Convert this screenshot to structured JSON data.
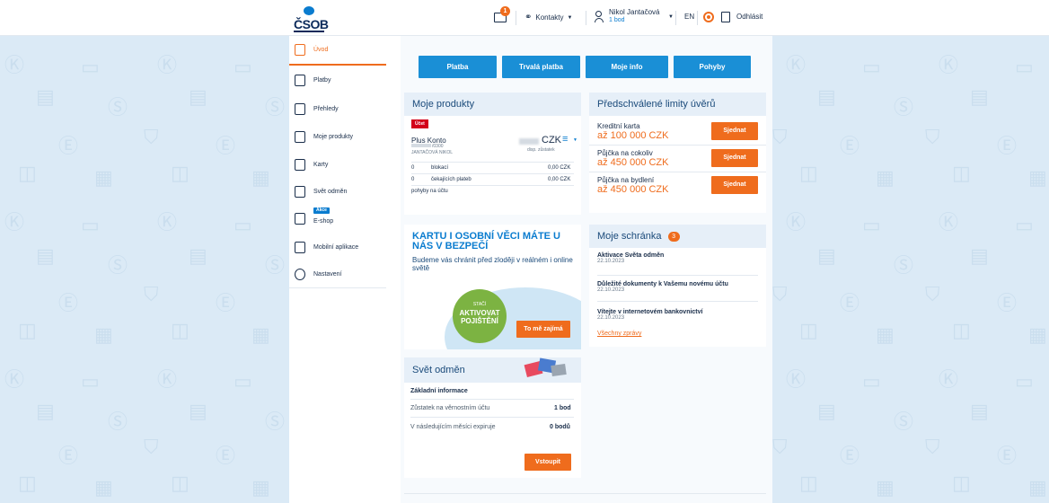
{
  "brand": {
    "logo_text": "ČSOB",
    "accent": "#ef6c1d",
    "primary": "#1a8fd6"
  },
  "header": {
    "mail_count": "1",
    "contacts_label": "Kontakty",
    "user_name": "Nikol Jantačová",
    "user_points": "1 bod",
    "lang": "EN",
    "logout_label": "Odhlásit"
  },
  "sidebar": {
    "items": [
      {
        "label": "Úvod",
        "icon": "home-icon",
        "active": true
      },
      {
        "label": "Platby",
        "icon": "payments-icon"
      },
      {
        "label": "Přehledy",
        "icon": "statements-icon"
      },
      {
        "label": "Moje produkty",
        "icon": "products-icon"
      },
      {
        "label": "Karty",
        "icon": "card-icon"
      },
      {
        "label": "Svět odměn",
        "icon": "gift-icon"
      },
      {
        "label": "E-shop",
        "icon": "shop-icon",
        "badge": "Akce"
      },
      {
        "label": "Mobilní aplikace",
        "icon": "mobile-icon"
      },
      {
        "label": "Nastavení",
        "icon": "gear-icon"
      }
    ]
  },
  "actions": [
    "Platba",
    "Trvalá platba",
    "Moje info",
    "Pohyby"
  ],
  "products": {
    "title": "Moje produkty",
    "badge": "Účet",
    "account_name": "Plus Konto",
    "account_number": "/0300",
    "holder": "JANTAČOVÁ NIKOL",
    "currency": "CZK",
    "balance_label": "disp. zůstatek",
    "rows": [
      {
        "count": "0",
        "label": "blokací",
        "amount": "0,00 CZK"
      },
      {
        "count": "0",
        "label": "čekajících plateb",
        "amount": "0,00 CZK"
      }
    ],
    "movements_label": "pohyby na účtu"
  },
  "limits": {
    "title": "Předschválené limity úvěrů",
    "items": [
      {
        "name": "Kreditní karta",
        "amount": "až 100 000 CZK",
        "button": "Sjednat"
      },
      {
        "name": "Půjčka na cokoliv",
        "amount": "až 450 000 CZK",
        "button": "Sjednat"
      },
      {
        "name": "Půjčka na bydlení",
        "amount": "až 450 000 CZK",
        "button": "Sjednat"
      }
    ]
  },
  "promo": {
    "headline": "KARTU I OSOBNÍ VĚCI MÁTE U NÁS V BEZPEČÍ",
    "text": "Budeme vás chránit před zloději v reálném i online světě",
    "circle_small": "STAČÍ",
    "circle_big": "AKTIVOVAT POJIŠTĚNÍ",
    "button": "To mě zajímá"
  },
  "inbox": {
    "title": "Moje schránka",
    "count": "3",
    "items": [
      {
        "subject": "Aktivace Světa odměn",
        "date": "22.10.2023"
      },
      {
        "subject": "Důležité dokumenty k Vašemu novému účtu",
        "date": "22.10.2023"
      },
      {
        "subject": "Vítejte v internetovém bankovnictví",
        "date": "22.10.2023"
      }
    ],
    "all_link": "Všechny zprávy"
  },
  "rewards": {
    "title": "Svět odměn",
    "section": "Základní informace",
    "rows": [
      {
        "label": "Zůstatek na věrnostním účtu",
        "value": "1 bod"
      },
      {
        "label": "V následujícím měsíci expiruje",
        "value": "0 bodů"
      }
    ],
    "button": "Vstoupit"
  }
}
